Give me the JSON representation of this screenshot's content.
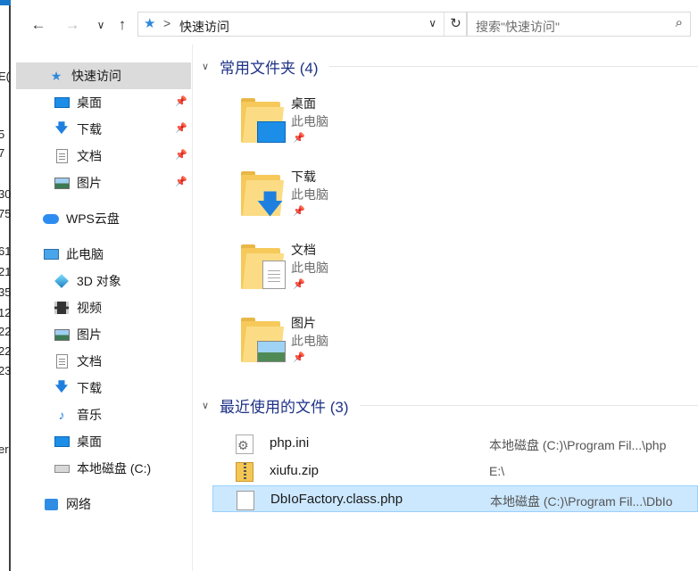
{
  "window": {
    "left_edge_labels": [
      "E(",
      "5",
      "7",
      "30",
      "75",
      "61",
      "21",
      "35",
      "12",
      "22",
      "22",
      "23",
      "er"
    ]
  },
  "toolbar": {
    "back_icon": "arrow-left-icon",
    "forward_icon": "arrow-right-icon",
    "recent_icon": "chevron-down-icon",
    "up_icon": "arrow-up-icon",
    "address": {
      "icon": "quick-access-star-icon",
      "separator": ">",
      "crumb": "快速访问"
    },
    "search_placeholder": "搜索\"快速访问\""
  },
  "nav": {
    "quick_access": "快速访问",
    "pinned": [
      {
        "label": "桌面",
        "icon": "desktop-icon"
      },
      {
        "label": "下载",
        "icon": "download-icon"
      },
      {
        "label": "文档",
        "icon": "documents-icon"
      },
      {
        "label": "图片",
        "icon": "pictures-icon"
      }
    ],
    "wps": "WPS云盘",
    "this_pc": "此电脑",
    "pc_items": [
      {
        "label": "3D 对象",
        "icon": "3d-objects-icon"
      },
      {
        "label": "视频",
        "icon": "videos-icon"
      },
      {
        "label": "图片",
        "icon": "pictures-icon"
      },
      {
        "label": "文档",
        "icon": "documents-icon"
      },
      {
        "label": "下载",
        "icon": "download-icon"
      },
      {
        "label": "音乐",
        "icon": "music-icon"
      },
      {
        "label": "桌面",
        "icon": "desktop-icon"
      },
      {
        "label": "本地磁盘 (C:)",
        "icon": "drive-icon"
      }
    ],
    "network": "网络"
  },
  "content": {
    "frequent": {
      "title": "常用文件夹 (4)",
      "folders": [
        {
          "name": "桌面",
          "location": "此电脑",
          "icon": "desktop-folder-icon"
        },
        {
          "name": "下载",
          "location": "此电脑",
          "icon": "download-folder-icon"
        },
        {
          "name": "文档",
          "location": "此电脑",
          "icon": "documents-folder-icon"
        },
        {
          "name": "图片",
          "location": "此电脑",
          "icon": "pictures-folder-icon"
        }
      ]
    },
    "recent": {
      "title": "最近使用的文件 (3)",
      "files": [
        {
          "name": "php.ini",
          "path": "本地磁盘 (C:)\\Program Fil...\\php",
          "icon": "ini-file-icon",
          "selected": false
        },
        {
          "name": "xiufu.zip",
          "path": "E:\\",
          "icon": "zip-file-icon",
          "selected": false
        },
        {
          "name": "DbIoFactory.class.php",
          "path": "本地磁盘 (C:)\\Program Fil...\\DbIo",
          "icon": "php-file-icon",
          "selected": true
        }
      ]
    }
  },
  "colors": {
    "section_title": "#1e3287",
    "selection": "#cce8ff",
    "nav_selection": "#dbdbdb",
    "accent_blue": "#1f7fde"
  }
}
